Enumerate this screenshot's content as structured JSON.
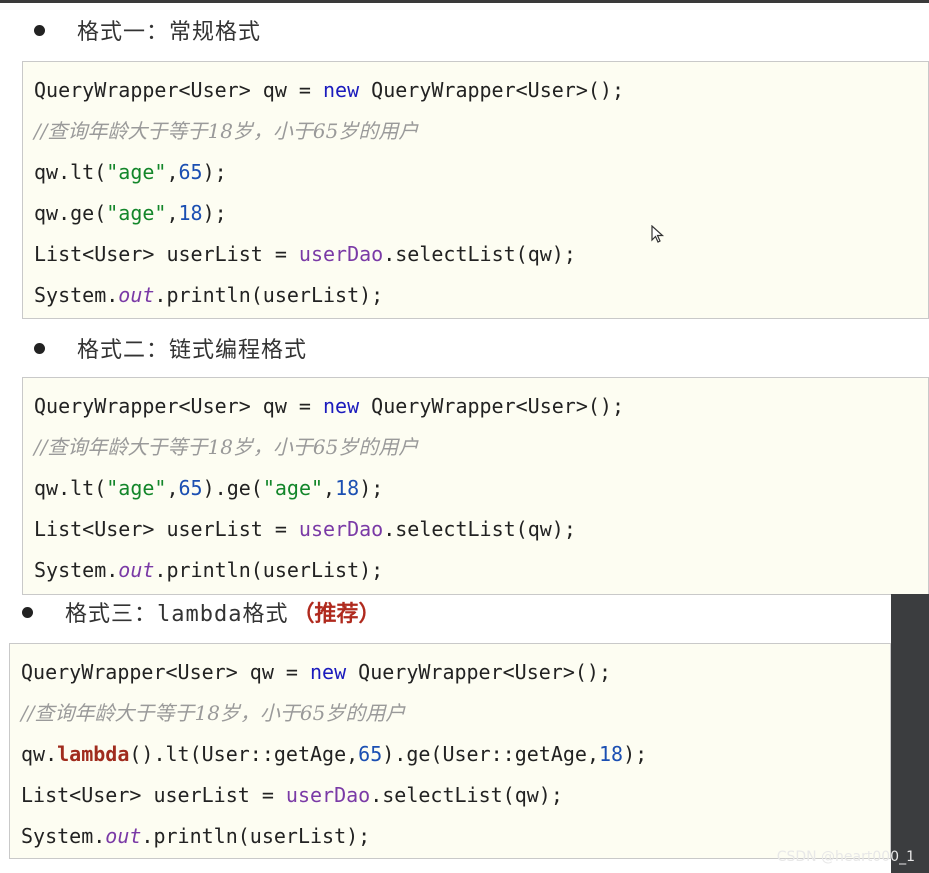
{
  "section1": {
    "heading": "格式一：常规格式",
    "code": {
      "l1_a": "QueryWrapper<User> qw = ",
      "l1_new": "new",
      "l1_b": " QueryWrapper<User>();",
      "comment": "//查询年龄大于等于18岁，小于65岁的用户",
      "l3_a": "qw.lt(",
      "l3_str": "\"age\"",
      "l3_c": ",",
      "l3_num": "65",
      "l3_d": ");",
      "l4_a": "qw.ge(",
      "l4_str": "\"age\"",
      "l4_c": ",",
      "l4_num": "18",
      "l4_d": ");",
      "l5_a": "List<User> userList = ",
      "l5_dao": "userDao",
      "l5_b": ".selectList(qw);",
      "l6_a": "System.",
      "l6_out": "out",
      "l6_b": ".println(userList);"
    }
  },
  "section2": {
    "heading": "格式二：链式编程格式",
    "code": {
      "l1_a": "QueryWrapper<User> qw = ",
      "l1_new": "new",
      "l1_b": " QueryWrapper<User>();",
      "comment": "//查询年龄大于等于18岁，小于65岁的用户",
      "l3_a": "qw.lt(",
      "l3_str1": "\"age\"",
      "l3_c1": ",",
      "l3_num1": "65",
      "l3_m": ").ge(",
      "l3_str2": "\"age\"",
      "l3_c2": ",",
      "l3_num2": "18",
      "l3_d": ");",
      "l4_a": "List<User> userList = ",
      "l4_dao": "userDao",
      "l4_b": ".selectList(qw);",
      "l5_a": "System.",
      "l5_out": "out",
      "l5_b": ".println(userList);"
    }
  },
  "section3": {
    "heading_a": "格式三：",
    "heading_mono": "lambda",
    "heading_b": "格式",
    "heading_rec": "（推荐）",
    "code": {
      "l1_a": "QueryWrapper<User> qw = ",
      "l1_new": "new",
      "l1_b": " QueryWrapper<User>();",
      "comment": "//查询年龄大于等于18岁，小于65岁的用户",
      "l3_a": "qw.",
      "l3_lam": "lambda",
      "l3_b": "().lt(User::getAge,",
      "l3_num1": "65",
      "l3_c": ").ge(User::getAge,",
      "l3_num2": "18",
      "l3_d": ");",
      "l4_a": "List<User> userList = ",
      "l4_dao": "userDao",
      "l4_b": ".selectList(qw);",
      "l5_a": "System.",
      "l5_out": "out",
      "l5_b": ".println(userList);"
    }
  },
  "watermark": "CSDN @heart000_1",
  "icons": {
    "cursor": "mouse-pointer-icon",
    "bullet": "bullet-dot-icon"
  }
}
